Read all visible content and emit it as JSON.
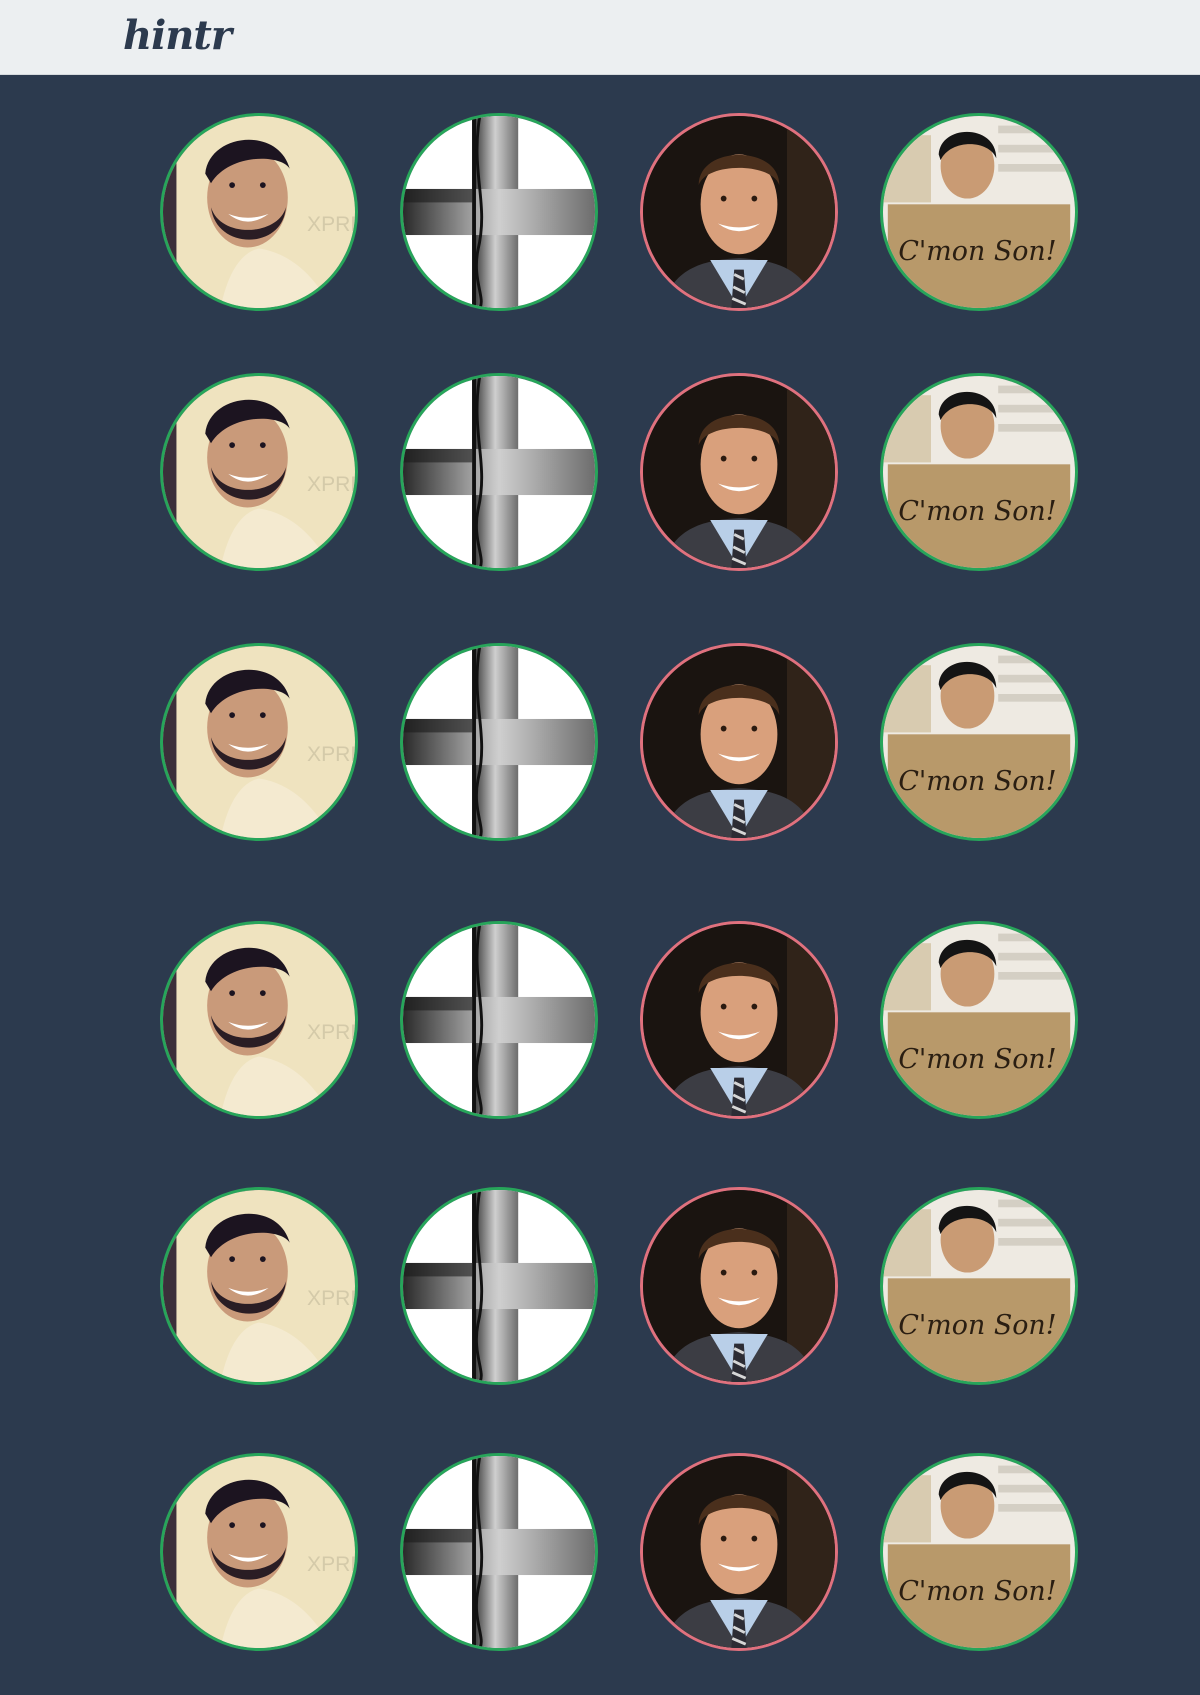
{
  "header": {
    "logo_text": "hintr"
  },
  "colors": {
    "background": "#2c3a4e",
    "header_bg": "#eceff1",
    "match_ring": "#27a55a",
    "pending_ring": "#e0717e"
  },
  "grid": {
    "rows": 6,
    "columns": [
      {
        "profile": "bearded-smiling-man",
        "ring": "green",
        "sign_text": ""
      },
      {
        "profile": "black-and-white-split-portrait",
        "ring": "green",
        "sign_text": ""
      },
      {
        "profile": "man-in-shirt-and-tie",
        "ring": "pink",
        "sign_text": ""
      },
      {
        "profile": "man-holding-cardboard-sign",
        "ring": "green",
        "sign_text": "C'mon Son!"
      }
    ]
  }
}
